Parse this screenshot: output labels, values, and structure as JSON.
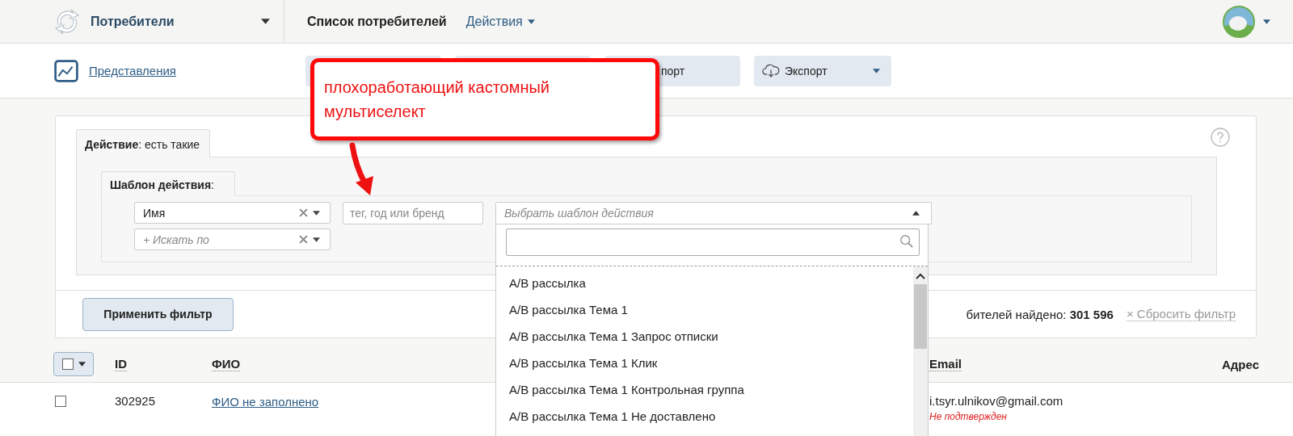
{
  "header": {
    "section": "Потребители",
    "title": "Список потребителей",
    "actions_menu": "Действия"
  },
  "toolbar": {
    "views_link": "Представления",
    "buttons": [
      {
        "kind": "blank"
      },
      {
        "kind": "blank"
      },
      {
        "kind": "plain",
        "label": "порт"
      },
      {
        "kind": "export",
        "label": "Экспорт"
      }
    ]
  },
  "callout": {
    "lines": [
      "плохоработающий кастомный",
      "мультиселект"
    ]
  },
  "filter": {
    "tab": "**Действие**: есть такие",
    "subtab": "**Шаблон действия**:",
    "conditions": [
      {
        "value": "Имя"
      },
      {
        "placeholder": "+ Искать по"
      }
    ],
    "tag_field": {
      "placeholder": "тег, год или бренд"
    },
    "multiselect": {
      "placeholder": "Выбрать шаблон действия",
      "expanded": true,
      "options": [
        "A/B рассылка",
        "A/B рассылка Тема 1",
        "A/B рассылка Тема 1 Запрос отписки",
        "A/B рассылка Тема 1 Клик",
        "A/B рассылка Тема 1 Контрольная группа",
        "A/B рассылка Тема 1 Не доставлено"
      ]
    },
    "apply_button": "Применить фильтр",
    "found": "бителей найдено: **301 596**",
    "reset": "× Сбросить фильтр"
  },
  "table": {
    "select_all": {
      "checked": false
    },
    "columns": [
      "ID",
      "ФИО",
      "Email",
      "Адрес"
    ],
    "rows": [
      {
        "checked": false,
        "id": "302925",
        "name": "ФИО не заполнено",
        "email": "i.tsyr.ulnikov@gmail.com",
        "email_status": "Не подтвержден"
      }
    ]
  }
}
